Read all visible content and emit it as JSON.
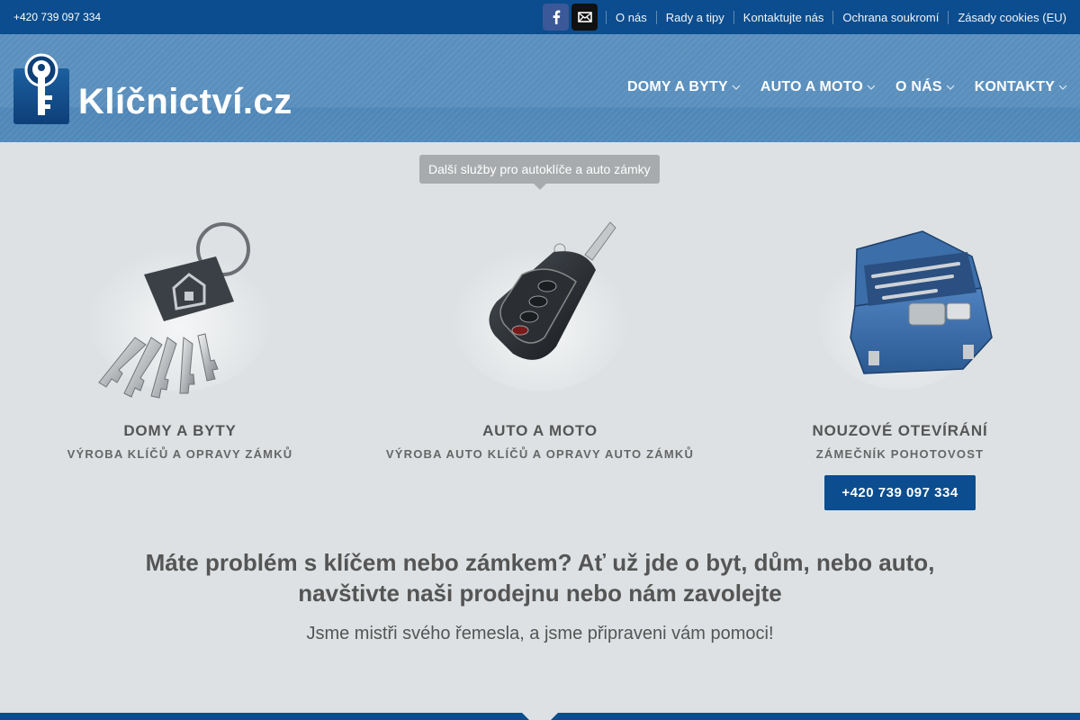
{
  "topbar": {
    "phone": "+420 739 097 334",
    "links": [
      "O nás",
      "Rady a tipy",
      "Kontaktujte nás",
      "Ochrana soukromí",
      "Zásady cookies (EU)"
    ]
  },
  "header": {
    "logo_text": "Klíčnictví.cz",
    "nav": [
      "DOMY A BYTY",
      "AUTO A MOTO",
      "O NÁS",
      "KONTAKTY"
    ]
  },
  "tooltip": "Další služby pro autoklíče a auto zámky",
  "columns": [
    {
      "title": "DOMY A BYTY",
      "subtitle": "VÝROBA KLÍČŮ A OPRAVY ZÁMKŮ"
    },
    {
      "title": "AUTO A MOTO",
      "subtitle": "VÝROBA AUTO KLÍČŮ A OPRAVY AUTO ZÁMKŮ"
    },
    {
      "title": "NOUZOVÉ OTEVÍRÁNÍ",
      "subtitle": "ZÁMEČNÍK POHOTOVOST",
      "button": "+420 739 097 334"
    }
  ],
  "headline_line1": "Máte problém s klíčem nebo zámkem? Ať už jde o byt, dům, nebo auto,",
  "headline_line2": "navštivte naši prodejnu nebo nám zavolejte",
  "tagline": "Jsme mistři svého řemesla, a jsme připraveni vám pomoci!",
  "icons": {
    "social": [
      "facebook-icon",
      "mail-icon"
    ],
    "nav_chevron": "chevron-down-icon"
  },
  "colors": {
    "primary": "#0b4d8e",
    "header": "#5a8fbd",
    "background": "#dde1e3",
    "text": "#555555",
    "tooltip": "#a8abad"
  }
}
